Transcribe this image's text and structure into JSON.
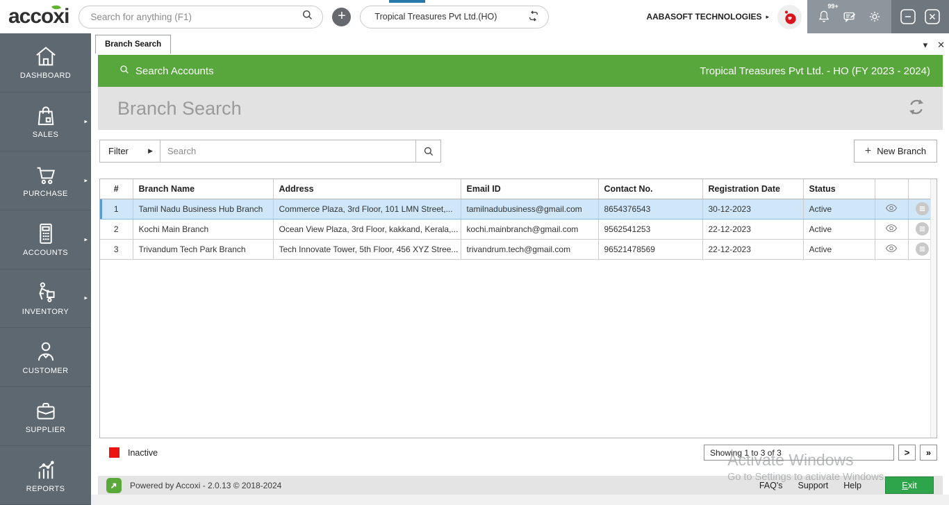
{
  "header": {
    "logo": "accoxi",
    "search_placeholder": "Search for anything (F1)",
    "company_selector": "Tropical Treasures Pvt Ltd.(HO)",
    "org_name": "AABASOFT TECHNOLOGIES",
    "notification_badge": "99+"
  },
  "icons": {
    "plus": "+",
    "caret_right_small": "▶",
    "caret_right_tiny": "▸",
    "caret_down": "▾",
    "close_tab": "✕",
    "page_next": ">",
    "page_last": "»"
  },
  "sidebar": {
    "items": [
      {
        "label": "DASHBOARD",
        "icon": "home",
        "has_arrow": false
      },
      {
        "label": "SALES",
        "icon": "shopping-bag",
        "has_arrow": true
      },
      {
        "label": "PURCHASE",
        "icon": "cart",
        "has_arrow": true
      },
      {
        "label": "ACCOUNTS",
        "icon": "calculator",
        "has_arrow": true
      },
      {
        "label": "INVENTORY",
        "icon": "hand-truck",
        "has_arrow": true
      },
      {
        "label": "CUSTOMER",
        "icon": "person",
        "has_arrow": false
      },
      {
        "label": "SUPPLIER",
        "icon": "briefcase",
        "has_arrow": false
      },
      {
        "label": "REPORTS",
        "icon": "bar-chart",
        "has_arrow": false
      }
    ]
  },
  "tabs": {
    "active": "Branch Search"
  },
  "green_bar": {
    "left": "Search Accounts",
    "right": "Tropical Treasures Pvt Ltd. - HO (FY 2023 - 2024)"
  },
  "page": {
    "title": "Branch Search"
  },
  "filter": {
    "label": "Filter",
    "search_placeholder": "Search"
  },
  "toolbar": {
    "new_branch_label": "New Branch"
  },
  "table": {
    "columns": [
      "#",
      "Branch Name",
      "Address",
      "Email ID",
      "Contact No.",
      "Registration Date",
      "Status"
    ],
    "rows": [
      {
        "num": "1",
        "branch": "Tamil Nadu Business Hub Branch",
        "address": "Commerce Plaza, 3rd Floor, 101 LMN Street,...",
        "email": "tamilnadubusiness@gmail.com",
        "contact": "8654376543",
        "reg_date": "30-12-2023",
        "status": "Active",
        "selected": true
      },
      {
        "num": "2",
        "branch": "Kochi Main Branch",
        "address": "Ocean View Plaza, 3rd Floor, kakkand, Kerala,...",
        "email": "kochi.mainbranch@gmail.com",
        "contact": "9562541253",
        "reg_date": "22-12-2023",
        "status": "Active",
        "selected": false
      },
      {
        "num": "3",
        "branch": "Trivandum Tech Park Branch",
        "address": "Tech Innovate Tower, 5th Floor, 456 XYZ Stree...",
        "email": "trivandrum.tech@gmail.com",
        "contact": "96521478569",
        "reg_date": "22-12-2023",
        "status": "Active",
        "selected": false
      }
    ]
  },
  "legend": {
    "inactive": "Inactive"
  },
  "pagination": {
    "showing": "Showing 1 to 3 of 3"
  },
  "statusbar": {
    "powered": "Powered by Accoxi - 2.0.13 © 2018-2024",
    "links": [
      "FAQ's",
      "Support",
      "Help"
    ],
    "exit_label": "Exit"
  },
  "watermark": {
    "line1": "Activate Windows",
    "line2": "Go to Settings to activate Windows."
  },
  "colors": {
    "accent_green": "#58a73c",
    "sidebar_gray": "#5e6870",
    "selected_row_blue": "#cfe7f9",
    "inactive_red": "#ec1313",
    "exit_green": "#2fa54b",
    "tray_gray": "#8e969d"
  }
}
